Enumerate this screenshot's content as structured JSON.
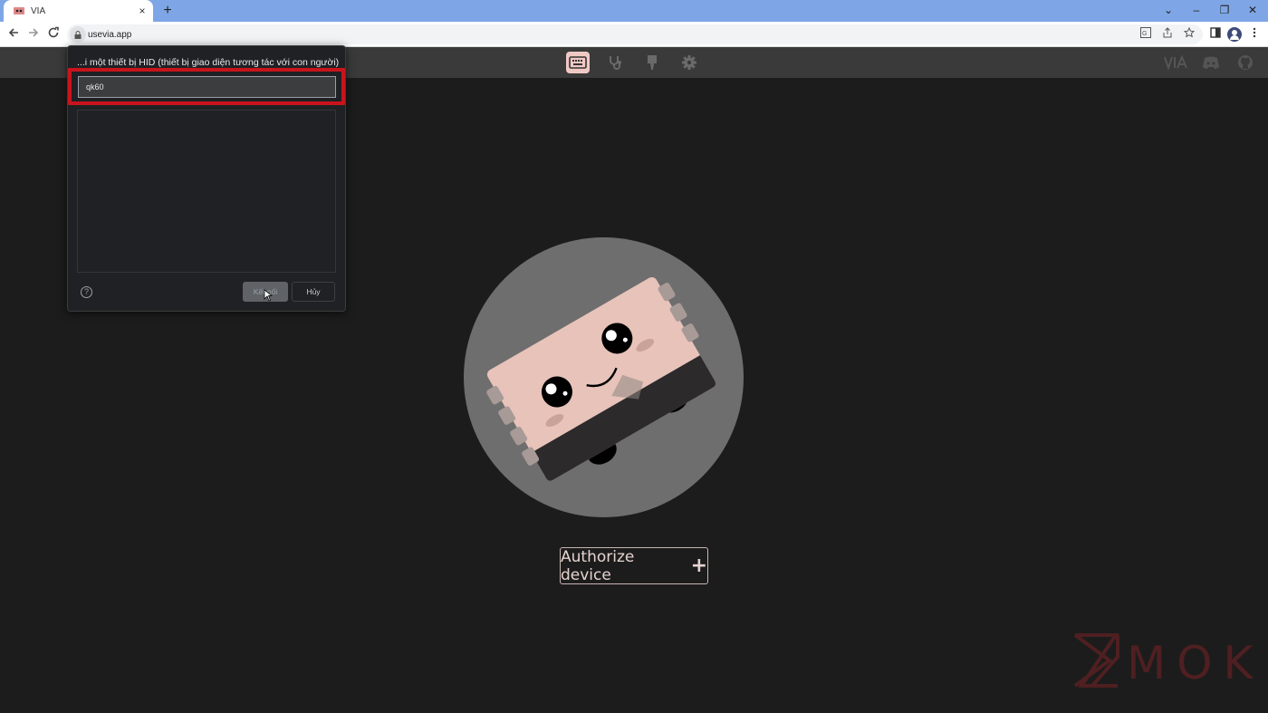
{
  "browser": {
    "tab_title": "VIA",
    "tab_close": "×",
    "new_tab": "+",
    "url": "usevia.app",
    "window_controls": [
      "⌄",
      "–",
      "❐",
      "✕"
    ]
  },
  "app": {
    "header_icons": [
      "keyboard-icon",
      "stethoscope-icon",
      "design-icon",
      "settings-icon"
    ],
    "header_right_icons": [
      "via-logo",
      "discord-icon",
      "github-icon"
    ],
    "authorize_label": "Authorize device",
    "authorize_plus": "+",
    "accent_color": "#f1c9c4"
  },
  "dialog": {
    "title": "...i một thiết bị HID (thiết bị giao diện tương tác với con người)",
    "device": "qk60",
    "connect_label": "Kết nối",
    "cancel_label": "Hủy",
    "help_glyph": "?",
    "highlight_color": "#c8141c"
  },
  "watermark": {
    "text": "MOKB"
  }
}
